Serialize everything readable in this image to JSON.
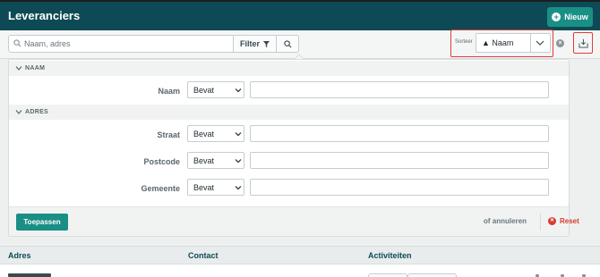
{
  "header": {
    "title": "Leveranciers",
    "new_label": "Nieuw"
  },
  "toolbar": {
    "search_placeholder": "Naam, adres",
    "filter_label": "Filter",
    "sort_label": "Sorteer",
    "sort_value": "▲ Naam"
  },
  "filters": {
    "sections": [
      {
        "title": "NAAM",
        "fields": [
          {
            "label": "Naam",
            "operator": "Bevat",
            "value": ""
          }
        ]
      },
      {
        "title": "ADRES",
        "fields": [
          {
            "label": "Straat",
            "operator": "Bevat",
            "value": ""
          },
          {
            "label": "Postcode",
            "operator": "Bevat",
            "value": ""
          },
          {
            "label": "Gemeente",
            "operator": "Bevat",
            "value": ""
          }
        ]
      }
    ],
    "apply_label": "Toepassen",
    "cancel_label": "of annuleren",
    "reset_label": "Reset"
  },
  "table": {
    "columns": [
      "Adres",
      "Contact",
      "Activiteiten"
    ]
  },
  "colors": {
    "header_bg": "#0e4a55",
    "accent": "#1a8f86",
    "highlight": "#e53935",
    "reset": "#d83b2e"
  }
}
